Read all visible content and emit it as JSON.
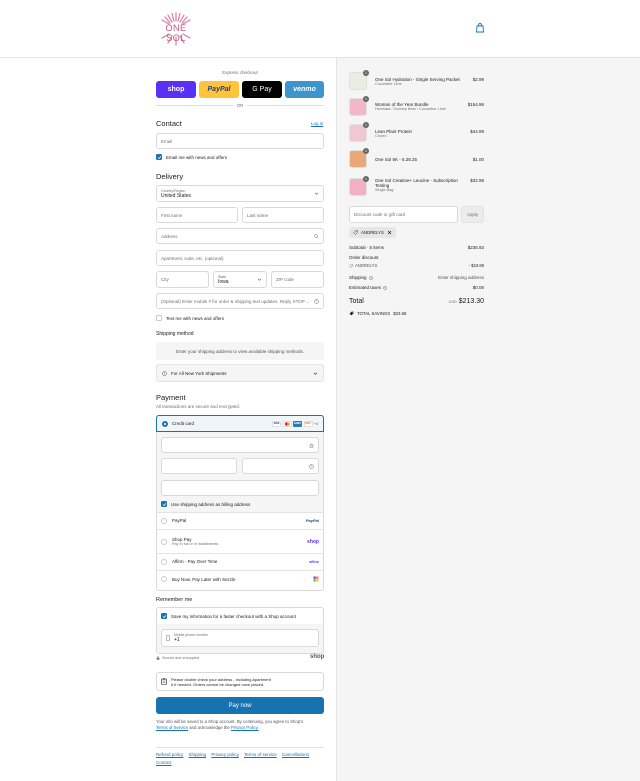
{
  "header": {
    "logo_text": "ONE SOL"
  },
  "express": {
    "label": "Express checkout",
    "shop": "shop",
    "paypal": "PayPal",
    "gpay": "G Pay",
    "venmo": "venmo",
    "or": "OR"
  },
  "contact": {
    "title": "Contact",
    "login": "Log in",
    "email_placeholder": "Email",
    "news_label": "Email me with news and offers"
  },
  "delivery": {
    "title": "Delivery",
    "country_label": "Country/Region",
    "country_value": "United States",
    "first_name": "First name",
    "last_name": "Last name",
    "address": "Address",
    "apartment": "Apartment, suite, etc. (optional)",
    "city": "City",
    "state_label": "State",
    "state_value": "Iowa",
    "zip": "ZIP code",
    "phone": "(Optional) Enter mobile # for order & shipping text updates. Reply STOP ...",
    "text_label": "Text me with news and offers"
  },
  "shipping": {
    "title": "Shipping method",
    "info": "Enter your shipping address to view available shipping methods.",
    "ny_label": "For All New York Shipments"
  },
  "payment": {
    "title": "Payment",
    "subtitle": "All transactions are secure and encrypted.",
    "credit_card": "Credit card",
    "card_more": "+4",
    "billing_label": "Use shipping address as billing address",
    "paypal": "PayPal",
    "paypal_logo": "PayPal",
    "shoppay": "Shop Pay",
    "shoppay_sub": "Pay in full or in installments",
    "shoppay_logo": "shop",
    "affirm": "Affirm - Pay Over Time",
    "affirm_logo": "affirm",
    "sezzle": "Buy Now, Pay Later with Sezzle"
  },
  "remember": {
    "title": "Remember me",
    "save_label": "Save my information for a faster checkout with a Shop account",
    "phone_label": "Mobile phone number",
    "phone_value": "+1",
    "secure": "Secure and encrypted",
    "shop_logo": "shop"
  },
  "notice": {
    "line1": "Please double check your address - including Apartment",
    "line2": "# if needed. Orders cannot be changed once placed."
  },
  "pay_now": "Pay now",
  "terms": {
    "line1": "Your info will be saved to a Shop account. By continuing, you agree to Shop's",
    "tos": "Terms of Service",
    "and": "and acknowledge the",
    "privacy": "Privacy Policy."
  },
  "footer": [
    "Refund policy",
    "Shipping",
    "Privacy policy",
    "Terms of service",
    "Cancellations",
    "Contact"
  ],
  "cart": {
    "items": [
      {
        "name": "One Sol Hydration - Single Serving Packet",
        "sub": "Cucumber Lime",
        "price": "$2.99",
        "qty": "1",
        "color": "#e8efe0"
      },
      {
        "name": "Woman of the Year Bundle",
        "sub": "Horchata / Gummy Bear / Cucumber Lime",
        "price": "$154.96",
        "qty": "1",
        "color": "#f2b8c8"
      },
      {
        "name": "Lean Plant Protein",
        "sub": "Churro",
        "price": "$44.99",
        "qty": "1",
        "color": "#f0c8d4"
      },
      {
        "name": "One Sol 5K - 6.28.25",
        "sub": "",
        "price": "$1.00",
        "qty": "1",
        "color": "#e8a878"
      },
      {
        "name": "One Sol Creatine+ Leucine - Subscription Testing",
        "sub": "Single Bag",
        "price": "$32.99",
        "qty": "1",
        "color": "#f2b0c4"
      }
    ],
    "discount_placeholder": "Discount code or gift card",
    "apply": "Apply",
    "code_tag": "ANDRELYS",
    "subtotal_label": "Subtotal · 5 items",
    "subtotal_value": "$236.93",
    "order_discount_label": "Order discount",
    "order_discount_code": "ANDRELYS",
    "order_discount_value": "- $23.69",
    "shipping_label": "Shipping",
    "shipping_value": "Enter shipping address",
    "taxes_label": "Estimated taxes",
    "taxes_value": "$0.06",
    "total_label": "Total",
    "currency": "USD",
    "total_value": "$213.30",
    "savings_label": "TOTAL SAVINGS",
    "savings_value": "$23.69"
  },
  "colors": {
    "accent": "#1773b0",
    "brand": "#c2567e"
  }
}
